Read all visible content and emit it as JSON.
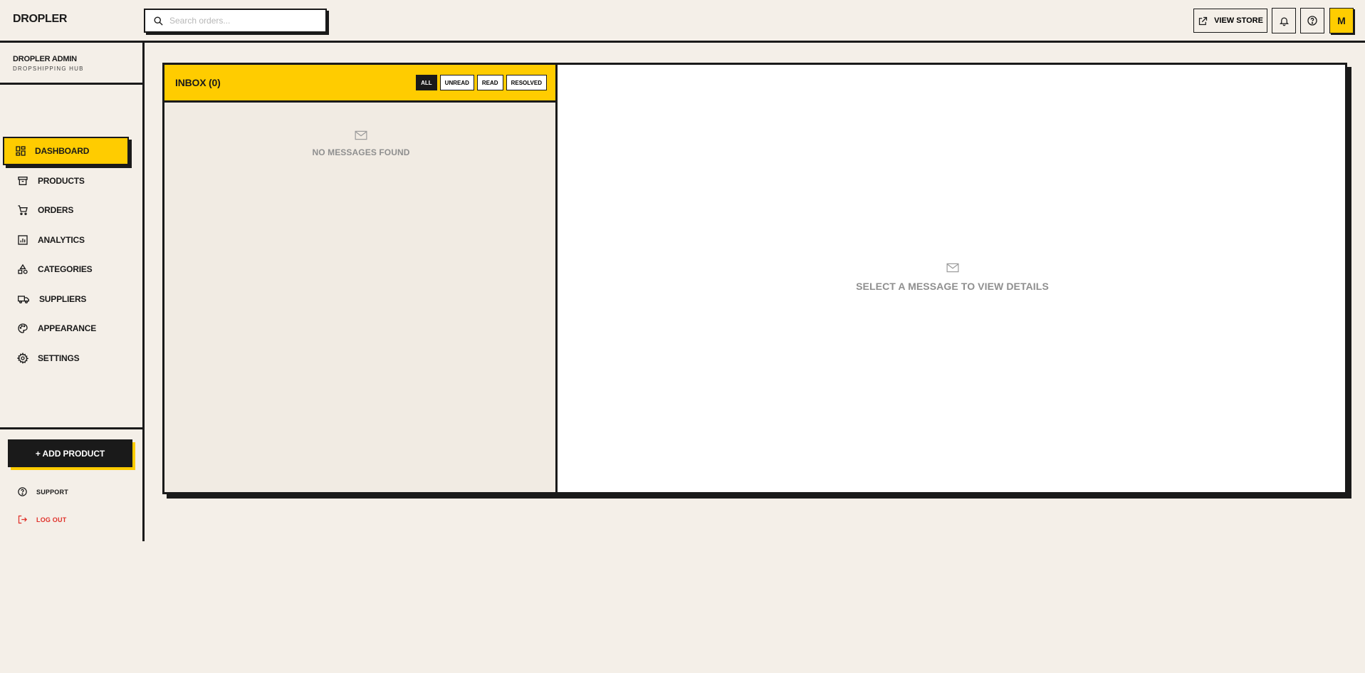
{
  "header": {
    "logo": "DROPLER",
    "search_placeholder": "Search orders...",
    "view_store_label": "VIEW STORE",
    "avatar_initial": "M"
  },
  "sidebar": {
    "brand_name": "DROPLER ADMIN",
    "brand_sub": "DROPSHIPPING HUB",
    "items": [
      {
        "label": "DASHBOARD",
        "icon": "dashboard-icon",
        "active": true
      },
      {
        "label": "PRODUCTS",
        "icon": "archive-icon"
      },
      {
        "label": "ORDERS",
        "icon": "cart-icon"
      },
      {
        "label": "ANALYTICS",
        "icon": "analytics-icon"
      },
      {
        "label": "CATEGORIES",
        "icon": "shapes-icon"
      },
      {
        "label": "SUPPLIERS",
        "icon": "truck-icon"
      },
      {
        "label": "APPEARANCE",
        "icon": "palette-icon"
      },
      {
        "label": "SETTINGS",
        "icon": "gear-icon"
      }
    ],
    "add_product_label": "+ ADD PRODUCT",
    "support_label": "SUPPORT",
    "logout_label": "LOG OUT"
  },
  "inbox": {
    "title": "INBOX (0)",
    "filters": [
      "ALL",
      "UNREAD",
      "READ",
      "RESOLVED"
    ],
    "active_filter": "ALL",
    "empty_text": "NO MESSAGES FOUND"
  },
  "detail": {
    "empty_text": "SELECT A MESSAGE TO VIEW DETAILS"
  },
  "colors": {
    "background": "#f4efe8",
    "accent": "#ffcc00",
    "ink": "#1a1a1a",
    "danger": "#e0312a",
    "muted": "#8f8f8f"
  }
}
